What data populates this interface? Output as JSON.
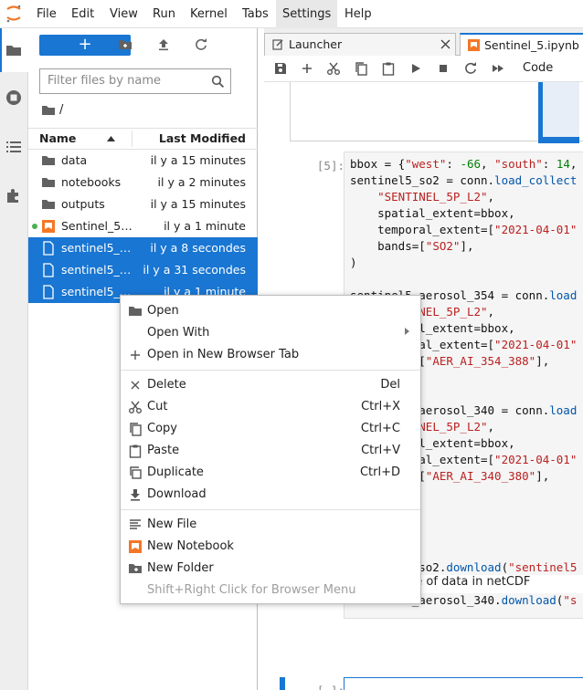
{
  "menubar": {
    "items": [
      {
        "label": "File"
      },
      {
        "label": "Edit"
      },
      {
        "label": "View"
      },
      {
        "label": "Run"
      },
      {
        "label": "Kernel"
      },
      {
        "label": "Tabs"
      },
      {
        "label": "Settings"
      },
      {
        "label": "Help"
      }
    ],
    "active": "Settings"
  },
  "filebrowser": {
    "new_button_label": "+",
    "filter_placeholder": "Filter files by name",
    "breadcrumb": "/",
    "columns": {
      "name": "Name",
      "modified": "Last Modified"
    },
    "files": [
      {
        "name": "data",
        "modified": "il y a 15 minutes",
        "type": "folder",
        "selected": false
      },
      {
        "name": "notebooks",
        "modified": "il y a 2 minutes",
        "type": "folder",
        "selected": false
      },
      {
        "name": "outputs",
        "modified": "il y a 15 minutes",
        "type": "folder",
        "selected": false
      },
      {
        "name": "Sentinel_5…",
        "modified": "il y a 1 minute",
        "type": "notebook",
        "selected": false
      },
      {
        "name": "sentinel5_…",
        "modified": "il y a 8 secondes",
        "type": "file",
        "selected": true
      },
      {
        "name": "sentinel5_…",
        "modified": "il y a 31 secondes",
        "type": "file",
        "selected": true
      },
      {
        "name": "sentinel5_…",
        "modified": "il y a 1 minute",
        "type": "file",
        "selected": true
      }
    ]
  },
  "tabs": [
    {
      "label": "Launcher"
    },
    {
      "label": "Sentinel_5.ipynb"
    }
  ],
  "notebook": {
    "cell_type": "Code",
    "prompt_5": "[5]:",
    "prompt_empty": "[ ]:",
    "markdown_text": "oad this slice of data in netCDF"
  },
  "context_menu": {
    "items": [
      {
        "label": "Open",
        "shortcut": "",
        "icon": "folder-icon"
      },
      {
        "label": "Open With",
        "shortcut": "",
        "icon": "",
        "submenu": true
      },
      {
        "label": "Open in New Browser Tab",
        "shortcut": "",
        "icon": "plus-icon"
      },
      {
        "label": "Delete",
        "shortcut": "Del",
        "icon": "close-icon"
      },
      {
        "label": "Cut",
        "shortcut": "Ctrl+X",
        "icon": "scissors-icon"
      },
      {
        "label": "Copy",
        "shortcut": "Ctrl+C",
        "icon": "copy-icon"
      },
      {
        "label": "Paste",
        "shortcut": "Ctrl+V",
        "icon": "paste-icon"
      },
      {
        "label": "Duplicate",
        "shortcut": "Ctrl+D",
        "icon": "duplicate-icon"
      },
      {
        "label": "Download",
        "shortcut": "",
        "icon": "download-icon"
      },
      {
        "label": "New File",
        "shortcut": "",
        "icon": "text-file-icon"
      },
      {
        "label": "New Notebook",
        "shortcut": "",
        "icon": "notebook-icon"
      },
      {
        "label": "New Folder",
        "shortcut": "",
        "icon": "new-folder-icon"
      },
      {
        "label": "Shift+Right Click for Browser Menu",
        "shortcut": "",
        "icon": "",
        "disabled": true
      }
    ]
  },
  "colors": {
    "accent": "#1976d2",
    "notebook_orange": "#f37726",
    "string": "#ba2121",
    "number": "#008000"
  }
}
